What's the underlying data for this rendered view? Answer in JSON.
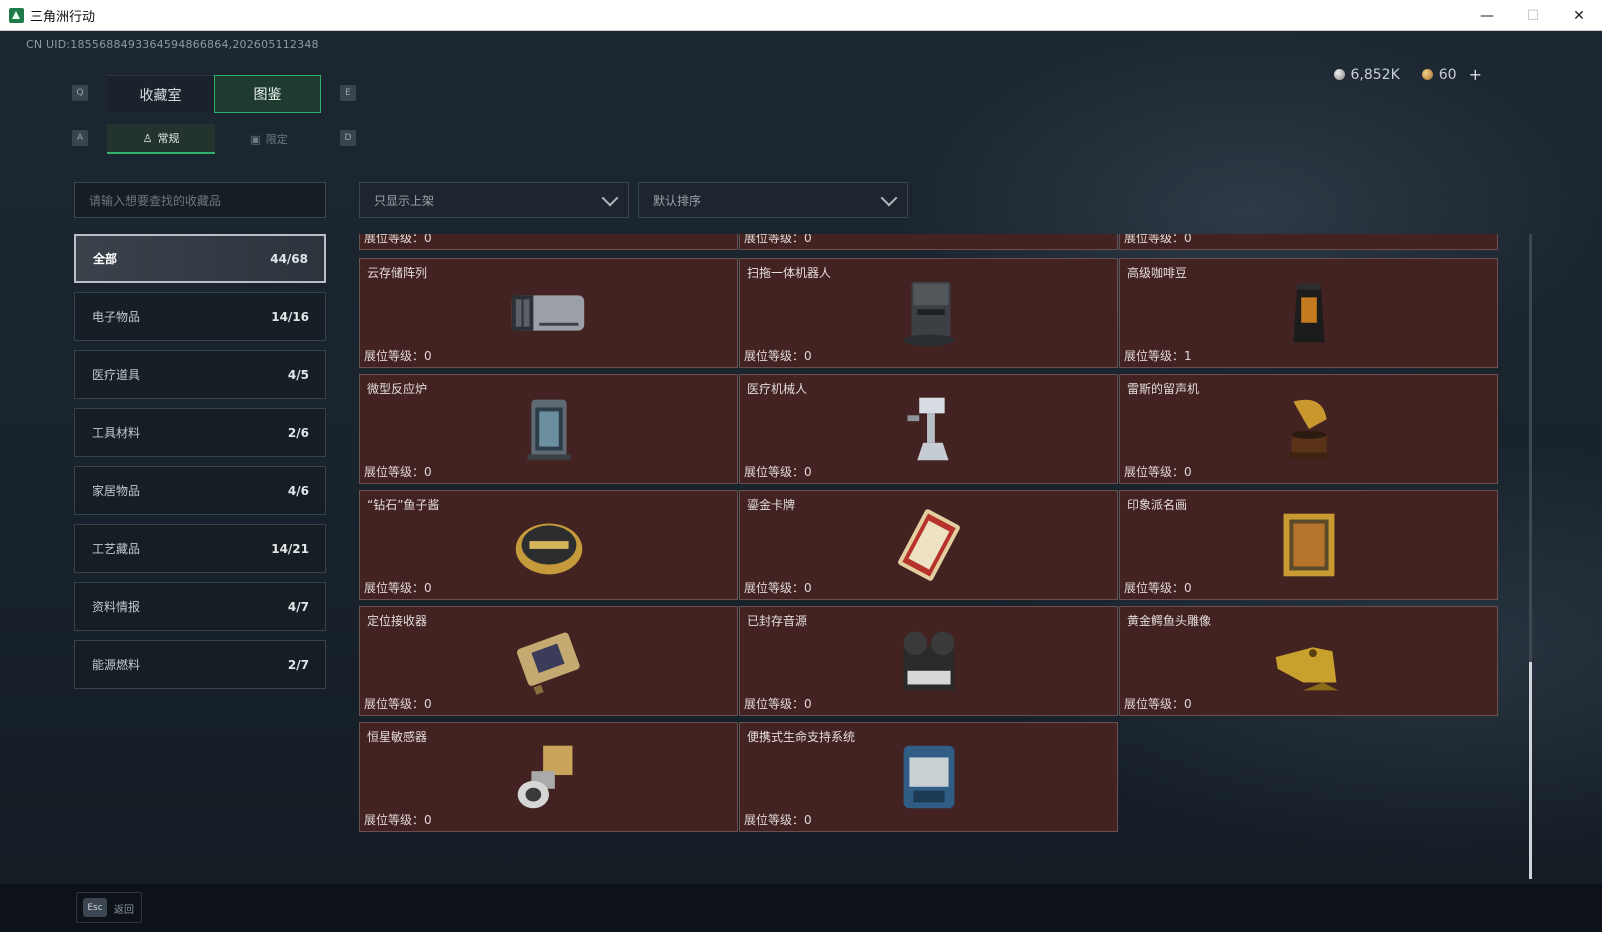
{
  "window": {
    "title": "三角洲行动",
    "minimize": "—",
    "maximize": "☐",
    "close": "✕"
  },
  "uid": "CN UID:1855688493364594866864,202605112348",
  "currency": {
    "silver": "6,852K",
    "gold": "60",
    "plus": "+"
  },
  "keys": {
    "prev_tab": "Q",
    "next_tab": "E",
    "prev_sub": "A",
    "next_sub": "D",
    "esc": "Esc"
  },
  "tabs": [
    {
      "label": "收藏室"
    },
    {
      "label": "图鉴"
    }
  ],
  "sub_tabs": [
    {
      "label": "常规"
    },
    {
      "label": "限定"
    }
  ],
  "search": {
    "placeholder": "请输入想要查找的收藏品"
  },
  "filters": {
    "display": "只显示上架",
    "sort": "默认排序"
  },
  "categories": [
    {
      "label": "全部",
      "count": "44/68"
    },
    {
      "label": "电子物品",
      "count": "14/16"
    },
    {
      "label": "医疗道具",
      "count": "4/5"
    },
    {
      "label": "工具材料",
      "count": "2/6"
    },
    {
      "label": "家居物品",
      "count": "4/6"
    },
    {
      "label": "工艺藏品",
      "count": "14/21"
    },
    {
      "label": "资料情报",
      "count": "4/7"
    },
    {
      "label": "能源燃料",
      "count": "2/7"
    }
  ],
  "level_label": "展位等级：",
  "partial_row_levels": [
    "0",
    "0",
    "0"
  ],
  "items": [
    {
      "name": "云存储阵列",
      "level": "0",
      "icon": "server-rack-icon"
    },
    {
      "name": "扫拖一体机器人",
      "level": "0",
      "icon": "robot-vacuum-icon"
    },
    {
      "name": "高级咖啡豆",
      "level": "1",
      "icon": "coffee-bag-icon"
    },
    {
      "name": "微型反应炉",
      "level": "0",
      "icon": "reactor-icon"
    },
    {
      "name": "医疗机械人",
      "level": "0",
      "icon": "medical-robot-icon"
    },
    {
      "name": "雷斯的留声机",
      "level": "0",
      "icon": "gramophone-icon"
    },
    {
      "name": "“钻石”鱼子酱",
      "level": "0",
      "icon": "caviar-tin-icon"
    },
    {
      "name": "鎏金卡牌",
      "level": "0",
      "icon": "gilded-card-icon"
    },
    {
      "name": "印象派名画",
      "level": "0",
      "icon": "painting-icon"
    },
    {
      "name": "定位接收器",
      "level": "0",
      "icon": "receiver-icon"
    },
    {
      "name": "已封存音源",
      "level": "0",
      "icon": "reel-recorder-icon"
    },
    {
      "name": "黄金鳄鱼头雕像",
      "level": "0",
      "icon": "croc-statue-icon"
    },
    {
      "name": "恒星敏感器",
      "level": "0",
      "icon": "star-sensor-icon"
    },
    {
      "name": "便携式生命支持系统",
      "level": "0",
      "icon": "life-support-icon"
    }
  ],
  "back_label": "返回",
  "colors": {
    "accent": "#2fb06d",
    "card_bg": "#432222",
    "card_border": "#6a5050"
  }
}
